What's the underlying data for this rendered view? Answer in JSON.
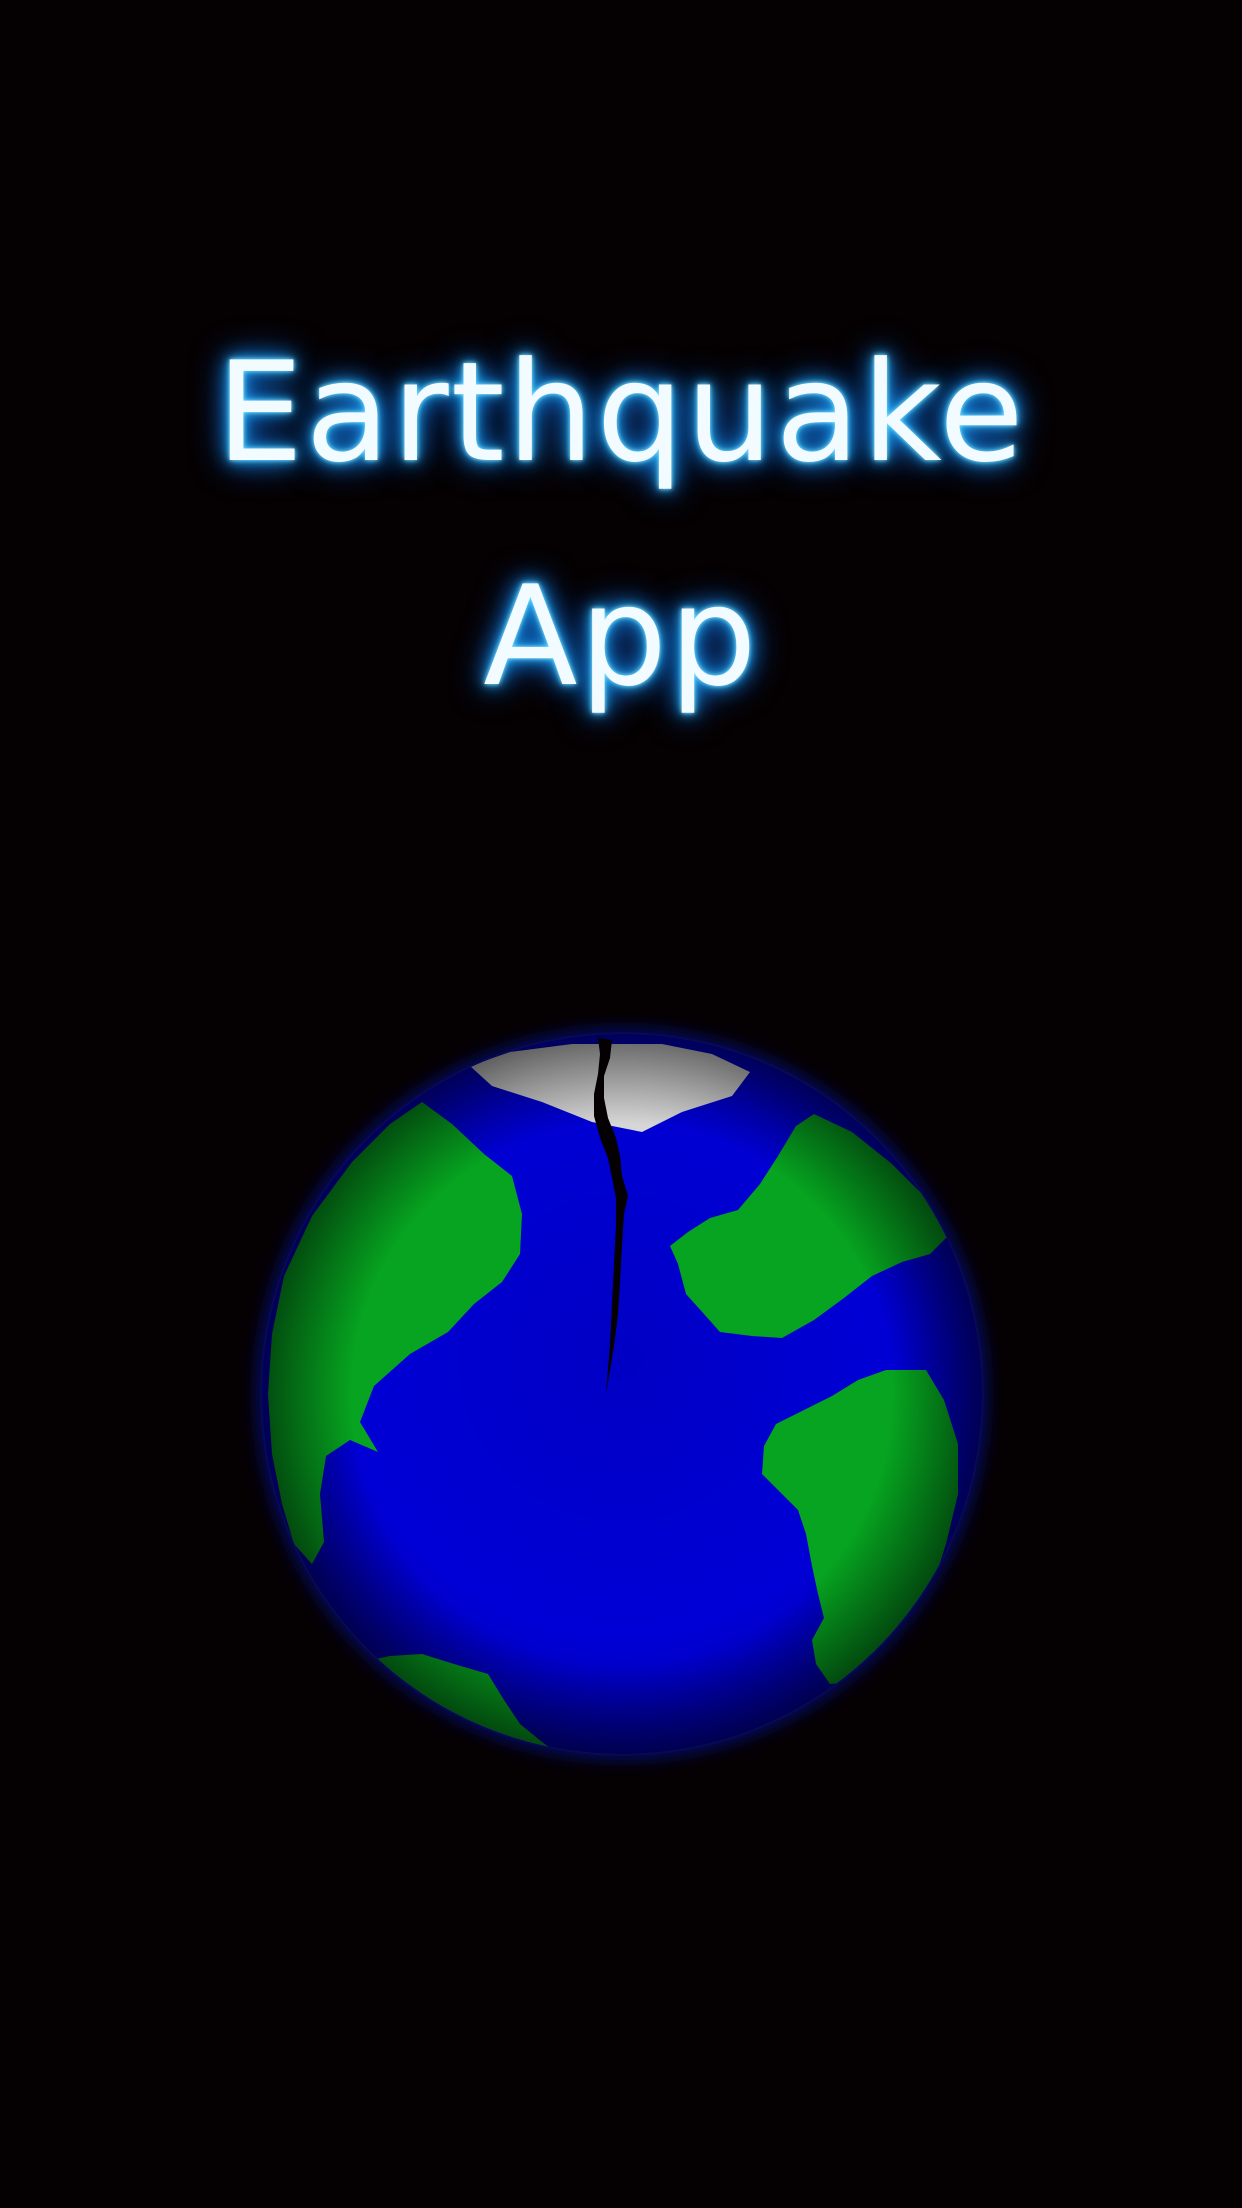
{
  "app": {
    "title_line_1": "Earthquake",
    "title_line_2": "App"
  },
  "globe": {
    "icon": "cracked-earth-globe-icon",
    "colors": {
      "ocean": "#0000d8",
      "land": "#06a420",
      "ice_cap": "#d6d6d6",
      "crack": "#000000",
      "glow": "#0a1cff"
    }
  },
  "theme": {
    "background": "#050102",
    "title_text": "#f2fbff",
    "title_glow": "#2fc2ff"
  }
}
